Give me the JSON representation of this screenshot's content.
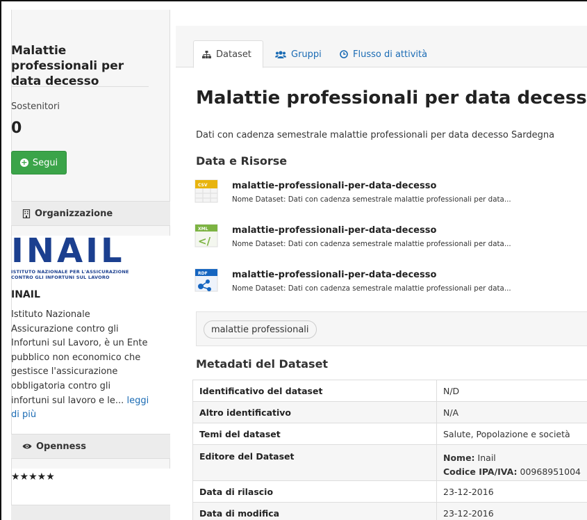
{
  "sidebar": {
    "title": "Malattie professionali per data decesso",
    "followers_label": "Sostenitori",
    "followers_count": "0",
    "follow_button": "Segui",
    "organization_heading": "Organizzazione",
    "org_logo": {
      "wordmark": "INAIL",
      "caption_line1": "ISTITUTO NAZIONALE PER L'ASSICURAZIONE",
      "caption_line2": "CONTRO GLI INFORTUNI SUL LAVORO"
    },
    "org_name": "INAIL",
    "org_description": "Istituto Nazionale Assicurazione contro gli Infortuni sul Lavoro, è un Ente pubblico non economico che gestisce l'assicurazione obbligatoria contro gli infortuni sul lavoro e le...",
    "read_more": "leggi di più",
    "openness_heading": "Openness",
    "openness_stars": "★★★★★"
  },
  "tabs": {
    "dataset": "Dataset",
    "gruppi": "Gruppi",
    "flusso": "Flusso di attività"
  },
  "main": {
    "title": "Malattie professionali per data decesso",
    "description": "Dati con cadenza semestrale malattie professionali per data decesso Sardegna",
    "resources_heading": "Data e Risorse",
    "resources": [
      {
        "format": "CSV",
        "name": "malattie-professionali-per-data-decesso",
        "description": "Nome Dataset: Dati con cadenza semestrale malattie professionali per data..."
      },
      {
        "format": "XML",
        "name": "malattie-professionali-per-data-decesso",
        "description": "Nome Dataset: Dati con cadenza semestrale malattie professionali per data..."
      },
      {
        "format": "RDF",
        "name": "malattie-professionali-per-data-decesso",
        "description": "Nome Dataset: Dati con cadenza semestrale malattie professionali per data..."
      }
    ],
    "tag": "malattie professionali",
    "metadata_heading": "Metadati del Dataset",
    "metadata": {
      "identifier_label": "Identificativo del dataset",
      "identifier_value": "N/D",
      "other_identifier_label": "Altro identificativo",
      "other_identifier_value": "N/A",
      "themes_label": "Temi del dataset",
      "themes_value": "Salute, Popolazione e società",
      "publisher_label": "Editore del Dataset",
      "publisher_name_label": "Nome:",
      "publisher_name_value": "Inail",
      "publisher_code_label": "Codice IPA/IVA:",
      "publisher_code_value": "00968951004",
      "release_label": "Data di rilascio",
      "release_value": "23-12-2016",
      "modified_label": "Data di modifica",
      "modified_value": "23-12-2016"
    }
  },
  "colors": {
    "link": "#1a6bb4",
    "follow_green": "#3ba449",
    "logo_blue": "#1b3f8f",
    "csv_yellow": "#e8b40e",
    "xml_green": "#7cb342",
    "rdf_blue": "#1565c0"
  }
}
